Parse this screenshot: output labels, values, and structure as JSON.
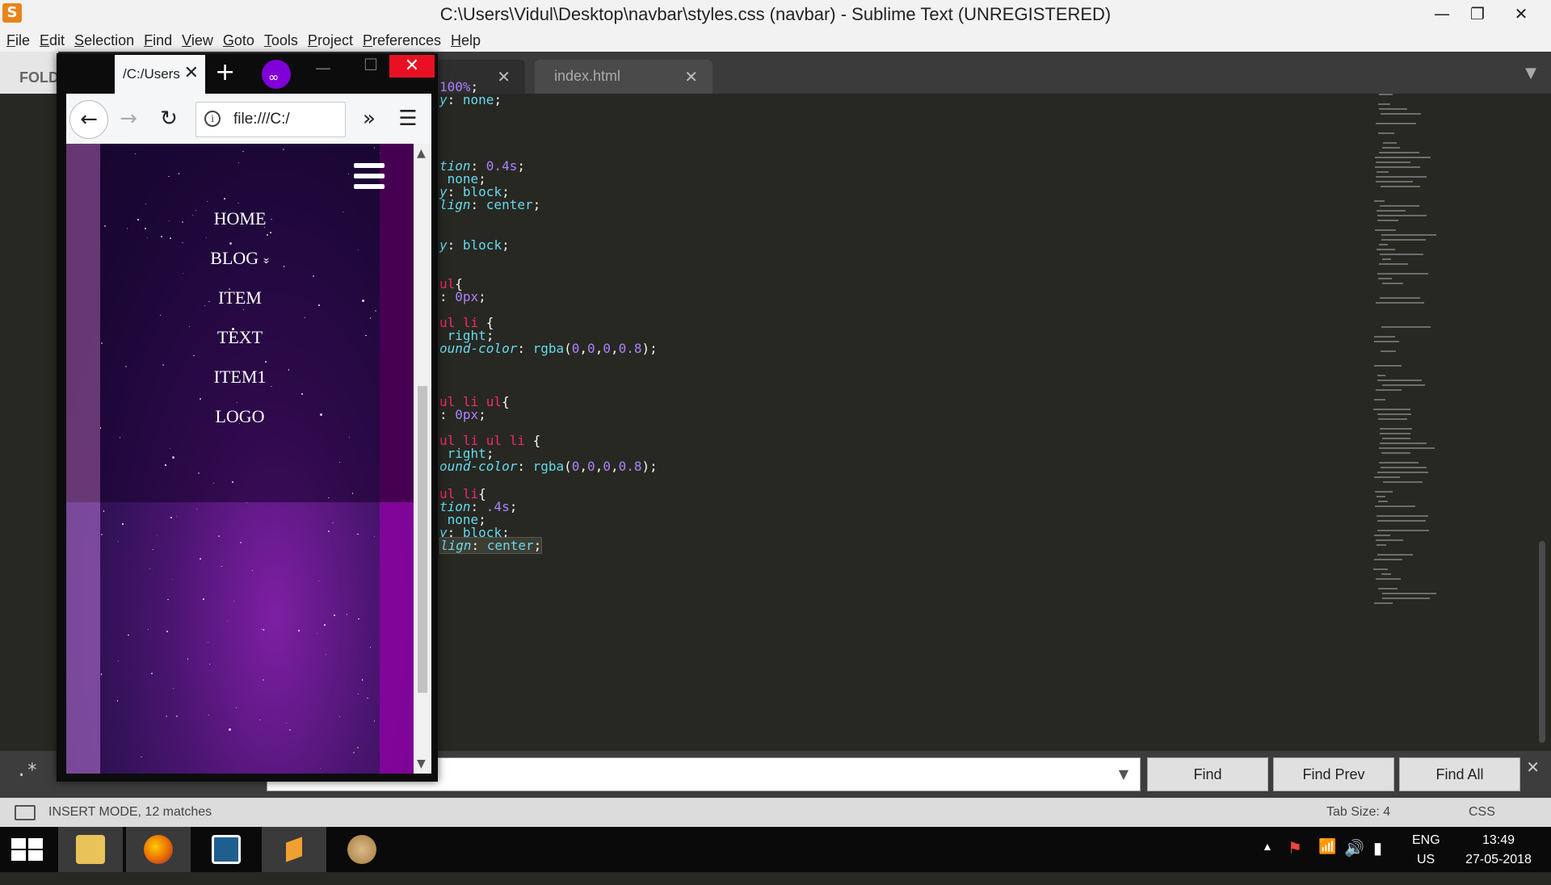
{
  "window": {
    "title": "C:\\Users\\Vidul\\Desktop\\navbar\\styles.css (navbar) - Sublime Text (UNREGISTERED)",
    "app_icon": "S"
  },
  "menu": [
    "File",
    "Edit",
    "Selection",
    "Find",
    "View",
    "Goto",
    "Tools",
    "Project",
    "Preferences",
    "Help"
  ],
  "sidebar": {
    "label": "FOLD"
  },
  "tabs": [
    {
      "label": ""
    },
    {
      "label": "index.html"
    }
  ],
  "code_lines": [
    {
      "html": "<span class='num'>100%</span>;"
    },
    {
      "html": "<span class='prop'>y</span>: <span class='val'>none</span>;"
    },
    {
      "html": "<span class='prop'>tion</span>: <span class='num'>0.4s</span>;"
    },
    {
      "html": " <span class='val'>none</span>;"
    },
    {
      "html": "<span class='prop'>y</span>: <span class='val'>block</span>;"
    },
    {
      "html": "<span class='prop'>lign</span>: <span class='val'>center</span>;"
    },
    {
      "html": "<span class='prop'>y</span>: <span class='val'>block</span>;"
    },
    {
      "html": "<span class='sel'>ul</span>{"
    },
    {
      "html": ": <span class='num'>0px</span>;"
    },
    {
      "html": "<span class='sel'>ul li</span> {"
    },
    {
      "html": " <span class='val'>right</span>;"
    },
    {
      "html": "<span class='prop'>ound-color</span>: <span class='fn'>rgba</span>(<span class='num'>0</span>,<span class='num'>0</span>,<span class='num'>0</span>,<span class='num'>0.8</span>);"
    },
    {
      "html": "<span class='sel'>ul li ul</span>{"
    },
    {
      "html": ": <span class='num'>0px</span>;"
    },
    {
      "html": "<span class='sel'>ul li ul li</span> {"
    },
    {
      "html": " <span class='val'>right</span>;"
    },
    {
      "html": "<span class='prop'>ound-color</span>: <span class='fn'>rgba</span>(<span class='num'>0</span>,<span class='num'>0</span>,<span class='num'>0</span>,<span class='num'>0.8</span>);"
    },
    {
      "html": "<span class='sel'>ul li</span>{"
    },
    {
      "html": "<span class='prop'>tion</span>: <span class='num'>.4s</span>;"
    },
    {
      "html": " <span class='val'>none</span>;"
    },
    {
      "html": "<span class='prop'>y</span>: <span class='val'>block</span>;"
    },
    {
      "html": "<span class='hl'><span class='prop'>lign</span>: <span class='val'>center</span>;</span>"
    }
  ],
  "find": {
    "regex_symbol": ".*",
    "dropdown": "▼",
    "find_label": "Find",
    "find_prev_label": "Find Prev",
    "find_all_label": "Find All",
    "close": "✕"
  },
  "status": {
    "mode": "INSERT MODE, 12 matches",
    "tab_size": "Tab Size: 4",
    "syntax": "CSS"
  },
  "firefox": {
    "tab_label": "/C:/Users",
    "url": "file:///C:/",
    "page_menu": [
      "HOME",
      "BLOG",
      "ITEM",
      "TEXT",
      "ITEM1",
      "LOGO"
    ],
    "blog_chevron": "»"
  },
  "tray": {
    "lang": "ENG",
    "region": "US",
    "time": "13:49",
    "date": "27-05-2018"
  },
  "colors": {
    "editor_bg": "#272822",
    "keyword": "#f92672",
    "number": "#ae81ff",
    "property": "#66d9ef",
    "ff_close": "#e81123",
    "ff_private": "#8000d7"
  }
}
